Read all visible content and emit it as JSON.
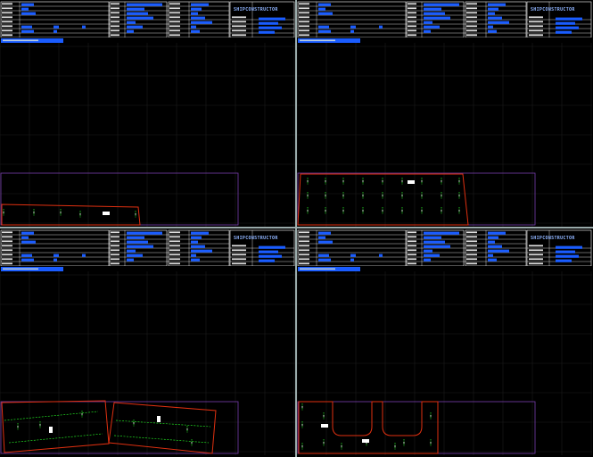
{
  "brand": "SHIPCONSTRUCTOR",
  "panes": [
    {
      "id": "top-left",
      "shape": "skewed-strip"
    },
    {
      "id": "top-right",
      "shape": "trapezoid-plate"
    },
    {
      "id": "bottom-left",
      "shape": "two-rotated-plates"
    },
    {
      "id": "bottom-right",
      "shape": "u-cutout-plate"
    }
  ],
  "colors": {
    "background": "#000000",
    "grid": "#1c1c1c",
    "header_bar": "#1a5cff",
    "plate_outline": "#e03010",
    "sheet_outline": "#7a3fae",
    "marks": "#22dd22",
    "label": "#ffffff"
  },
  "icons": [
    "grid-canvas",
    "brand-logo"
  ]
}
